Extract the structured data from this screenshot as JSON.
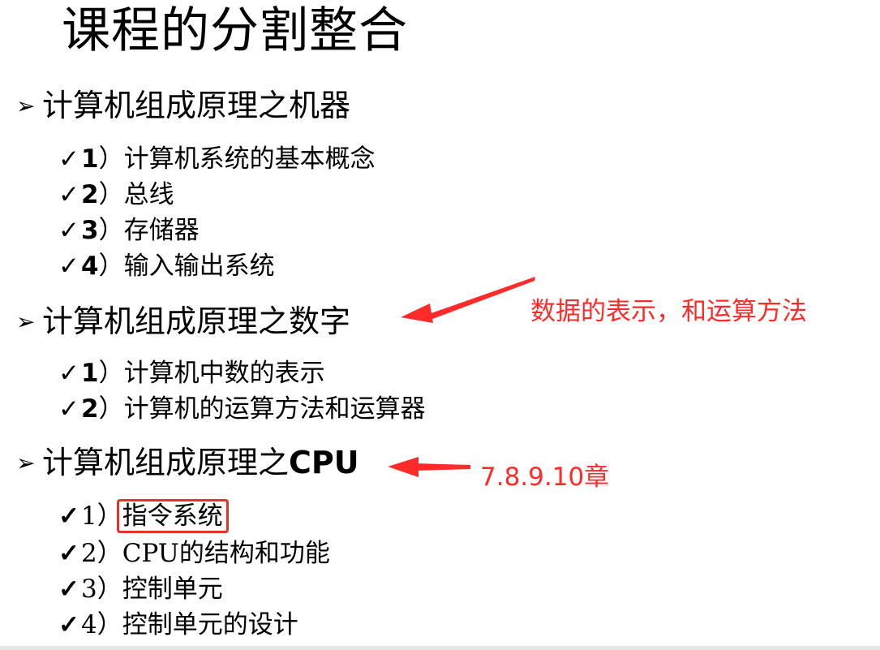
{
  "title": "课程的分割整合",
  "sections": [
    {
      "heading": "计算机组成原理之机器",
      "items": [
        {
          "num": "1",
          "paren": "）",
          "text": "计算机系统的基本概念"
        },
        {
          "num": "2",
          "paren": "）",
          "text": "总线"
        },
        {
          "num": "3",
          "paren": "）",
          "text": "存储器"
        },
        {
          "num": "4",
          "paren": "）",
          "text": "输入输出系统"
        }
      ]
    },
    {
      "heading": "计算机组成原理之数字",
      "items": [
        {
          "num": "1",
          "paren": "）",
          "text": "计算机中数的表示"
        },
        {
          "num": "2",
          "paren": "）",
          "text": "计算机的运算方法和运算器"
        }
      ]
    },
    {
      "heading_prefix": "计算机组成原理之",
      "heading_suffix": "CPU",
      "items": [
        {
          "num": "1",
          "paren": "）",
          "text": "指令系统"
        },
        {
          "num": "2",
          "paren": "）",
          "text": "CPU的结构和功能"
        },
        {
          "num": "3",
          "paren": "）",
          "text": "控制单元"
        },
        {
          "num": "4",
          "paren": "）",
          "text": "控制单元的设计"
        }
      ]
    }
  ],
  "symbols": {
    "bullet": "➢",
    "check": "✓"
  },
  "annotations": {
    "note_numbers": "数据的表示，和运算方法",
    "note_chapters": "7.8.9.10章"
  },
  "colors": {
    "annotation": "#ff2a2a",
    "highlight_box": "#e5322a"
  }
}
